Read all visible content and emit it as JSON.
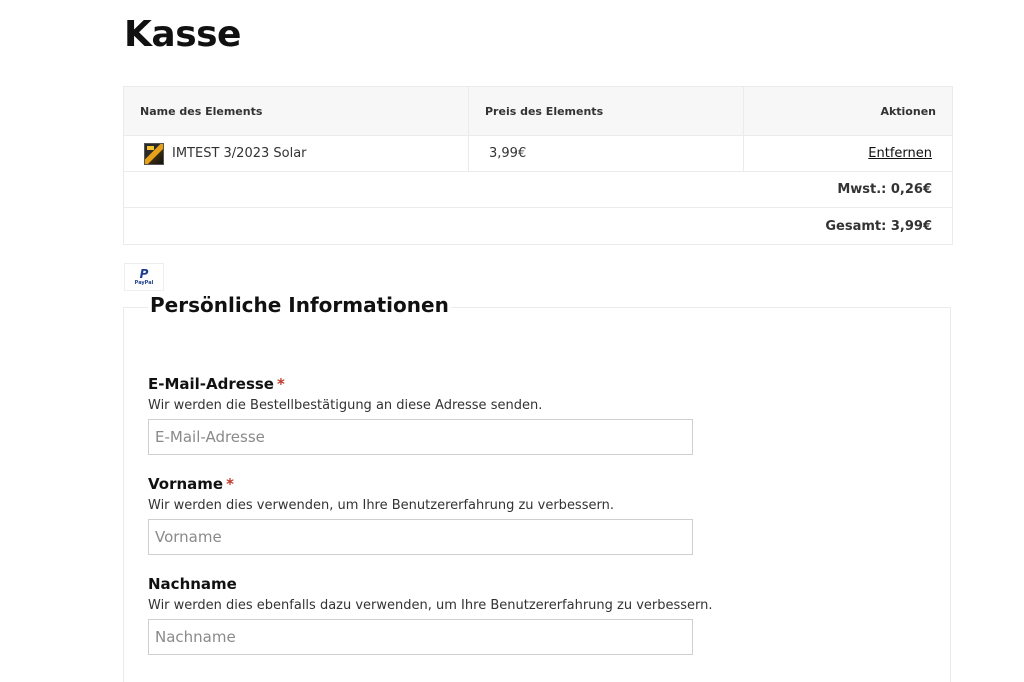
{
  "page": {
    "title": "Kasse"
  },
  "cart": {
    "headers": {
      "name": "Name des Elements",
      "price": "Preis des Elements",
      "actions": "Aktionen"
    },
    "items": [
      {
        "name": "IMTEST 3/2023 Solar",
        "price": "3,99€",
        "action": "Entfernen"
      }
    ],
    "tax_label": "Mwst.: 0,26€",
    "total_label": "Gesamt: 3,99€"
  },
  "payment": {
    "badge_text": "PayPal",
    "badge_mark": "P"
  },
  "personal_info": {
    "title": "Persönliche Informationen",
    "fields": [
      {
        "label": "E-Mail-Adresse",
        "required": "*",
        "hint": "Wir werden die Bestellbestätigung an diese Adresse senden.",
        "placeholder": "E-Mail-Adresse",
        "value": ""
      },
      {
        "label": "Vorname",
        "required": "*",
        "hint": "Wir werden dies verwenden, um Ihre Benutzererfahrung zu verbessern.",
        "placeholder": "Vorname",
        "value": ""
      },
      {
        "label": "Nachname",
        "required": "",
        "hint": "Wir werden dies ebenfalls dazu verwenden, um Ihre Benutzererfahrung zu verbessern.",
        "placeholder": "Nachname",
        "value": ""
      }
    ]
  },
  "colors": {
    "required": "#c0392b",
    "border": "#ebebeb",
    "header_bg": "#f7f7f7",
    "paypal": "#1f3f8f"
  }
}
